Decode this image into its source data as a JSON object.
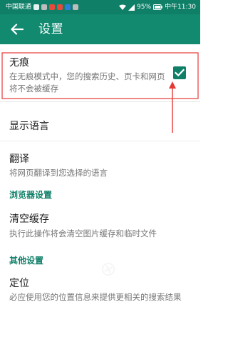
{
  "status_bar": {
    "carrier": "中国联通",
    "battery": "95%",
    "time": "中午11:30"
  },
  "app_bar": {
    "title": "设置",
    "back_icon": "arrow-left-icon"
  },
  "settings": {
    "incognito": {
      "title": "无痕",
      "summary": "在无痕模式中，您的搜索历史、页卡和网页将不会被缓存",
      "checked": true
    },
    "language": {
      "title": "显示语言"
    },
    "translate": {
      "title": "翻译",
      "summary": "将网页翻译到您选择的语言"
    },
    "browser_section": "浏览器设置",
    "clear_cache": {
      "title": "清空缓存",
      "summary": "执行此操作将会清空图片缓存和临时文件"
    },
    "other_section": "其他设置",
    "location": {
      "title": "定位",
      "summary": "必应使用您的位置信息来提供更相关的搜索结果"
    }
  },
  "colors": {
    "status_bar": "#0f7f68",
    "app_bar": "#118a70",
    "accent": "#0f7f68",
    "annotation": "#e53935"
  }
}
